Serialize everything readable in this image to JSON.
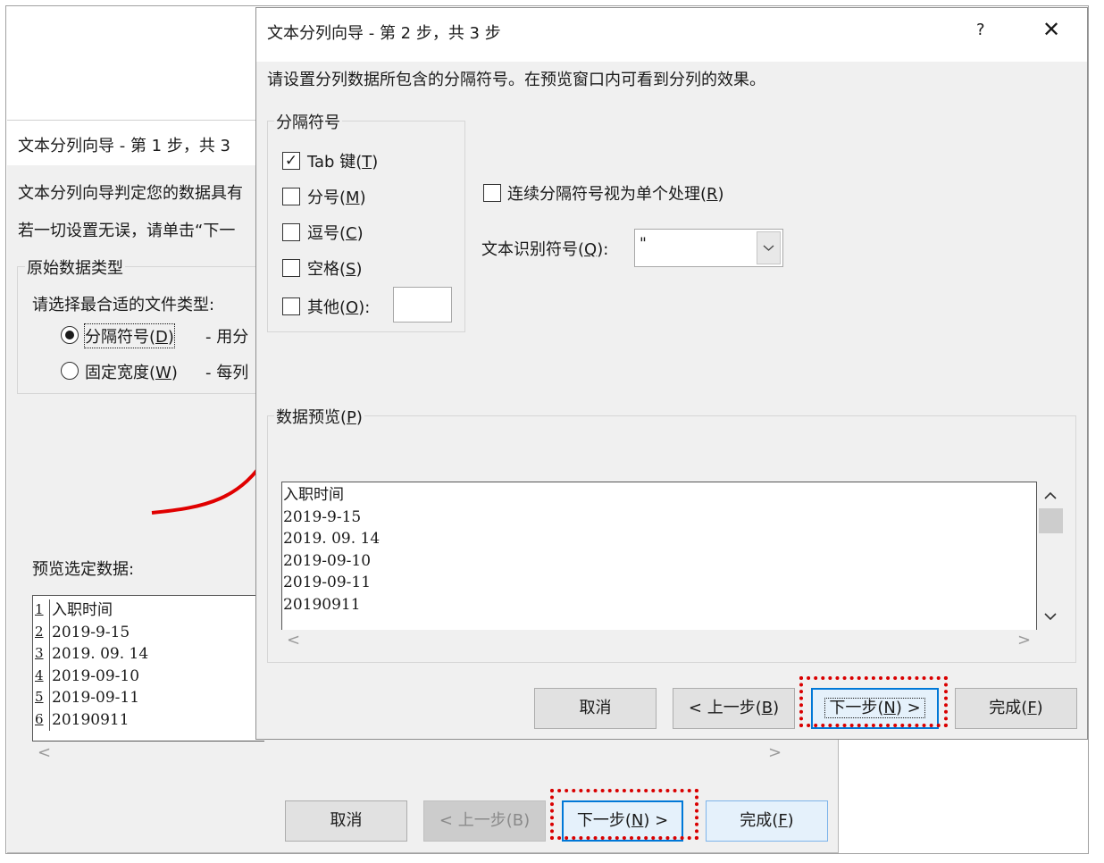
{
  "step1": {
    "title": "文本分列向导 - 第 1 步，共 3",
    "desc1": "文本分列向导判定您的数据具有",
    "desc2": "若一切设置无误，请单击“下一",
    "group_title": "原始数据类型",
    "choose_label": "请选择最合适的文件类型:",
    "opt_delimited": {
      "label_pre": "分隔符号(",
      "key": "D",
      "label_post": ")",
      "desc": "- 用分"
    },
    "opt_fixed": {
      "label_pre": "固定宽度(",
      "key": "W",
      "label_post": ")",
      "desc": "- 每列"
    },
    "preview_label": "预览选定数据:",
    "preview_rows": [
      {
        "num": "1",
        "text": "入职时间"
      },
      {
        "num": "2",
        "text": "2019-9-15"
      },
      {
        "num": "3",
        "text": "2019. 09. 14"
      },
      {
        "num": "4",
        "text": "2019-09-10"
      },
      {
        "num": "5",
        "text": "2019-09-11"
      },
      {
        "num": "6",
        "text": "20190911"
      }
    ],
    "buttons": {
      "cancel": "取消",
      "back": "< 上一步(B)",
      "next_pre": "下一步(",
      "next_key": "N",
      "next_post": ") >",
      "finish_pre": "完成(",
      "finish_key": "F",
      "finish_post": ")"
    },
    "scroll_left": "<",
    "scroll_right": ">"
  },
  "step2": {
    "title": "文本分列向导 - 第 2 步，共 3 步",
    "help": "?",
    "close": "✕",
    "instruction": "请设置分列数据所包含的分隔符号。在预览窗口内可看到分列的效果。",
    "delim_group_title": "分隔符号",
    "checkboxes": [
      {
        "pre": "Tab 键(",
        "key": "T",
        "post": ")",
        "checked": true
      },
      {
        "pre": "分号(",
        "key": "M",
        "post": ")",
        "checked": false
      },
      {
        "pre": "逗号(",
        "key": "C",
        "post": ")",
        "checked": false
      },
      {
        "pre": "空格(",
        "key": "S",
        "post": ")",
        "checked": false
      },
      {
        "pre": "其他(",
        "key": "O",
        "post": "):",
        "checked": false
      }
    ],
    "check_mark": "✓",
    "consecutive": {
      "pre": "连续分隔符号视为单个处理(",
      "key": "R",
      "post": ")",
      "checked": false
    },
    "qualifier": {
      "pre": "文本识别符号(",
      "key": "Q",
      "post": "):",
      "value": "\""
    },
    "preview_title_pre": "数据预览(",
    "preview_title_key": "P",
    "preview_title_post": ")",
    "preview_lines": [
      "入职时间",
      "2019-9-15",
      "2019. 09. 14",
      "2019-09-10",
      "2019-09-11",
      "20190911"
    ],
    "buttons": {
      "cancel": "取消",
      "back_pre": "< 上一步(",
      "back_key": "B",
      "back_post": ")",
      "next_pre": "下一步(",
      "next_key": "N",
      "next_post": ") >",
      "finish_pre": "完成(",
      "finish_key": "F",
      "finish_post": ")"
    },
    "scroll_up": "^",
    "scroll_down": "v",
    "scroll_left": "<",
    "scroll_right": ">"
  },
  "colors": {
    "annotation_red": "#d90000",
    "focus_blue": "#0078d7"
  }
}
